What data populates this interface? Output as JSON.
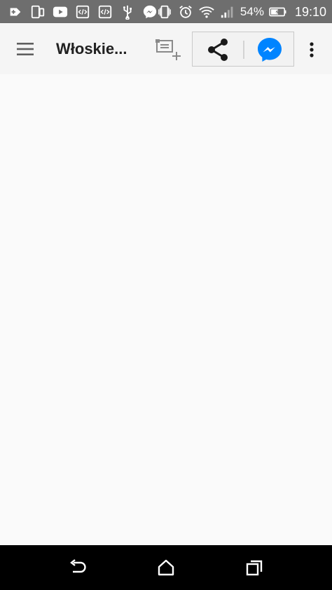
{
  "status_bar": {
    "battery_percent": "54%",
    "time": "19:10",
    "icons": [
      "add-box-icon",
      "dual-screen-icon",
      "youtube-icon",
      "code-icon",
      "code-icon",
      "usb-icon",
      "messenger-icon",
      "vibrate-icon",
      "alarm-icon",
      "wifi-icon",
      "signal-icon",
      "battery-charging-icon"
    ]
  },
  "app_bar": {
    "title": "Włoskie...",
    "menu_icon": "hamburger-menu-icon",
    "add_icon": "add-to-list-icon",
    "share_icon": "share-icon",
    "messenger_icon": "messenger-icon",
    "overflow_icon": "more-vert-icon",
    "accent": "#0084ff"
  },
  "nav_bar": {
    "icons": [
      "back-icon",
      "home-icon",
      "recent-apps-icon"
    ]
  }
}
